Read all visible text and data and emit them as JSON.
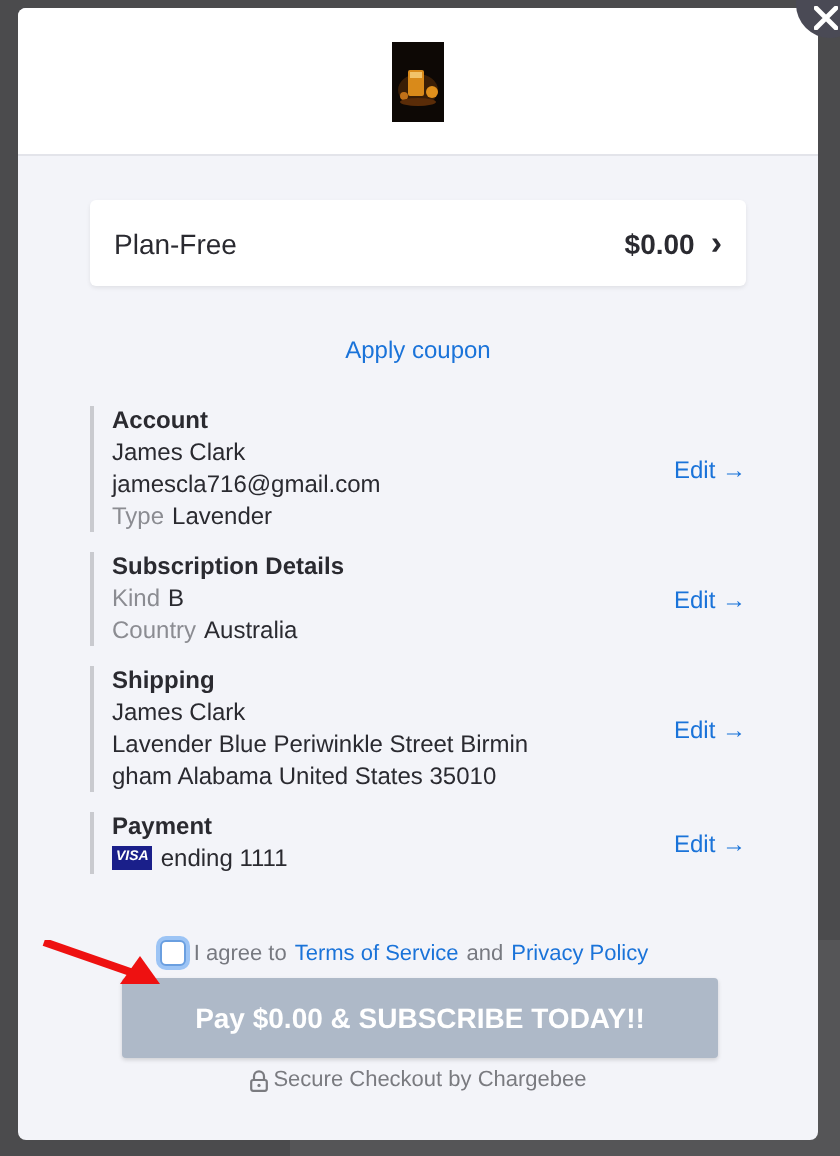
{
  "modal": {
    "plan": {
      "name": "Plan-Free",
      "price": "$0.00",
      "chevron": "›"
    },
    "coupon_link": "Apply coupon",
    "sections": [
      {
        "title": "Account",
        "lines": [
          {
            "kind": "text",
            "value": "James Clark"
          },
          {
            "kind": "text",
            "value": "jamescla716@gmail.com"
          },
          {
            "kind": "field",
            "label": "Type",
            "value": "Lavender"
          }
        ],
        "edit": "Edit →"
      },
      {
        "title": "Subscription Details",
        "lines": [
          {
            "kind": "field",
            "label": "Kind",
            "value": "B"
          },
          {
            "kind": "field",
            "label": "Country",
            "value": "Australia"
          }
        ],
        "edit": "Edit →"
      },
      {
        "title": "Shipping",
        "lines": [
          {
            "kind": "text",
            "value": "James Clark"
          },
          {
            "kind": "text",
            "value": "Lavender Blue Periwinkle Street Birmin"
          },
          {
            "kind": "text",
            "value": "gham Alabama United States 35010"
          }
        ],
        "edit": "Edit →"
      },
      {
        "title": "Payment",
        "lines": [
          {
            "kind": "card",
            "badge": "VISA",
            "value": "ending 1111"
          }
        ],
        "edit": "Edit →"
      }
    ],
    "agreement": {
      "checked": false,
      "prefix": "I agree to",
      "terms": "Terms of Service",
      "middle": "and",
      "privacy": "Privacy Policy"
    },
    "pay_button": {
      "label": "Pay $0.00 & SUBSCRIBE TODAY!!",
      "disabled": true
    },
    "secure_note": "Secure Checkout by Chargebee"
  },
  "annotation": {
    "kind": "arrow",
    "color": "#ee1111"
  }
}
